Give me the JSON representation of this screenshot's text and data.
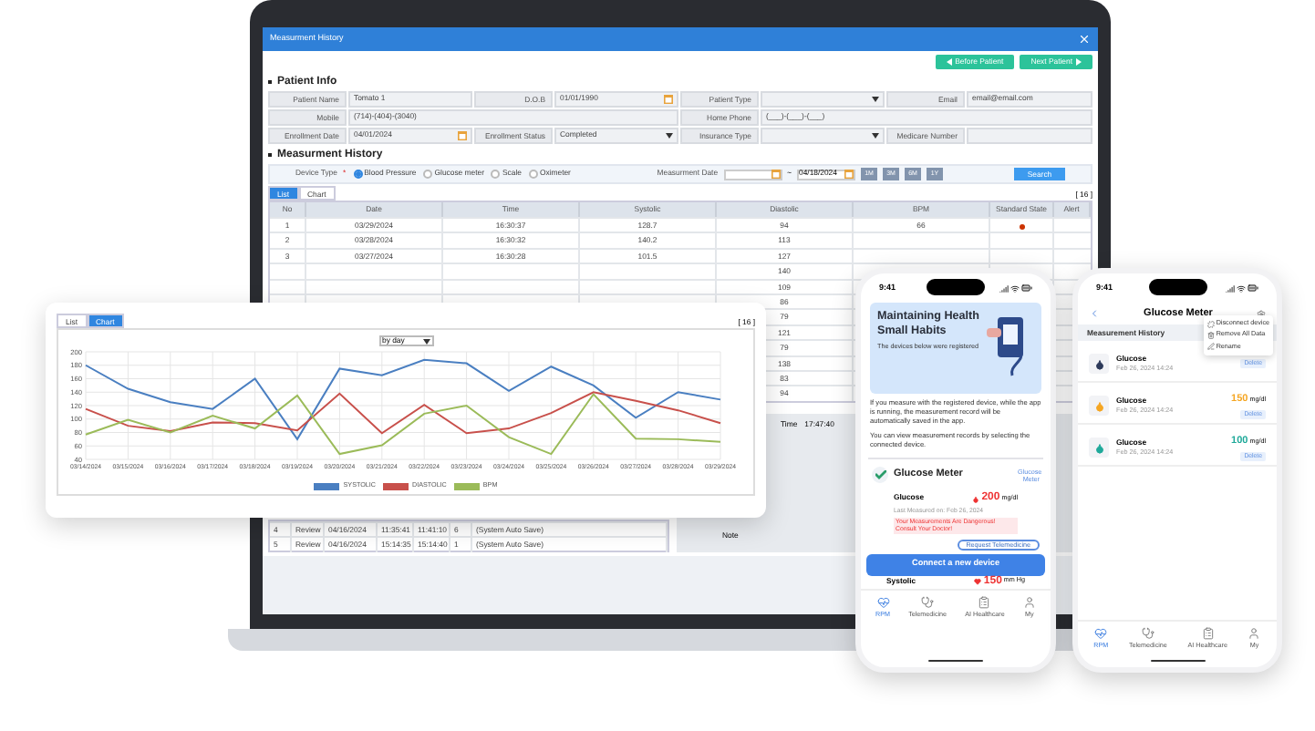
{
  "laptop_window": {
    "title": "Measurment History",
    "nav_buttons": [
      {
        "label": "Before Patient",
        "kind": "prev"
      },
      {
        "label": "Next Patient",
        "kind": "next"
      }
    ],
    "patient_info": {
      "heading": "Patient Info",
      "fields": [
        {
          "label": "Patient Name",
          "value": "Tomato 1",
          "kind": "text"
        },
        {
          "label": "D.O.B",
          "value": "01/01/1990",
          "kind": "date"
        },
        {
          "label": "Patient Type",
          "kind": "select"
        },
        {
          "label": "Email",
          "value": "email@email.com",
          "kind": "text"
        },
        {
          "label": "Mobile",
          "value": "(714)-(404)-(3040)",
          "kind": "wide"
        },
        {
          "label": "Home Phone",
          "value": "(___)-(___)-(___)",
          "kind": "wide"
        },
        {
          "label": "Enrollment Date",
          "value": "04/01/2024",
          "kind": "date"
        },
        {
          "label": "Enrollment Status",
          "value": "Completed",
          "kind": "select"
        },
        {
          "label": "Insurance Type",
          "kind": "select"
        },
        {
          "label": "Medicare Number",
          "kind": "text"
        }
      ]
    },
    "history": {
      "heading": "Measurment History",
      "device_type_label": "Device Type",
      "required_mark": "*",
      "device_options": [
        {
          "label": "Blood Pressure",
          "selected": true
        },
        {
          "label": "Glucose meter",
          "selected": false
        },
        {
          "label": "Scale",
          "selected": false
        },
        {
          "label": "Oximeter",
          "selected": false
        }
      ],
      "date_label": "Measurment Date",
      "date_separator": "~",
      "date_to": "04/18/2024",
      "ranges": [
        "1M",
        "3M",
        "6M",
        "1Y"
      ],
      "search": "Search",
      "tabs": [
        {
          "label": "List",
          "selected": true
        },
        {
          "label": "Chart",
          "selected": false
        }
      ],
      "count": "[ 16 ]",
      "table": {
        "columns": [
          "No",
          "Date",
          "Time",
          "Systolic",
          "Diastolic",
          "BPM",
          "Standard State",
          "Alert"
        ],
        "rows": [
          {
            "no": "1",
            "date": "03/29/2024",
            "time": "16:30:37",
            "systolic": "128.7",
            "diastolic": "94",
            "bpm": "66",
            "color": "#cc3300"
          },
          {
            "no": "2",
            "date": "03/28/2024",
            "time": "16:30:32",
            "systolic": "140.2",
            "diastolic": "113"
          },
          {
            "no": "3",
            "date": "03/27/2024",
            "time": "16:30:28",
            "systolic": "101.5",
            "diastolic": "127"
          },
          {
            "diastolic": "140"
          },
          {
            "diastolic": "109"
          },
          {
            "diastolic": "86"
          },
          {
            "diastolic": "79"
          },
          {
            "diastolic": "121"
          },
          {
            "diastolic": "79"
          },
          {
            "diastolic": "138"
          },
          {
            "diastolic": "83"
          },
          {
            "diastolic": "94"
          }
        ]
      },
      "log": {
        "rows": [
          [
            "4",
            "Review",
            "04/16/2024",
            "11:35:41",
            "11:41:10",
            "6",
            "(System Auto Save)"
          ],
          [
            "5",
            "Review",
            "04/16/2024",
            "15:14:35",
            "15:14:40",
            "1",
            "(System Auto Save)"
          ]
        ],
        "time_label": "Time",
        "time_value": "17:47:40",
        "note": "Note"
      }
    }
  },
  "chart_card": {
    "tabs": [
      {
        "label": "List",
        "selected": false
      },
      {
        "label": "Chart",
        "selected": true
      }
    ],
    "count": "[ 16 ]",
    "period": "by day",
    "chart_data": {
      "type": "line",
      "grid": true,
      "legend": true,
      "x": [
        "03/14/2024",
        "03/15/2024",
        "03/16/2024",
        "03/17/2024",
        "03/18/2024",
        "03/19/2024",
        "03/20/2024",
        "03/21/2024",
        "03/22/2024",
        "03/23/2024",
        "03/24/2024",
        "03/25/2024",
        "03/26/2024",
        "03/27/2024",
        "03/28/2024",
        "03/29/2024"
      ],
      "ylim": [
        40,
        200
      ],
      "yticks": [
        40,
        60,
        80,
        100,
        120,
        140,
        160,
        180,
        200
      ],
      "series": [
        {
          "name": "SYSTOLIC",
          "color": "#4a7fc1",
          "values": [
            180,
            145,
            125,
            115,
            160,
            70,
            175,
            165,
            188,
            183,
            142,
            178,
            150,
            102,
            140,
            129
          ]
        },
        {
          "name": "DIASTOLIC",
          "color": "#c8504b",
          "values": [
            115,
            90,
            82,
            95,
            94,
            83,
            138,
            79,
            121,
            79,
            86,
            109,
            140,
            127,
            113,
            94
          ]
        },
        {
          "name": "BPM",
          "color": "#9bbb59",
          "values": [
            77,
            99,
            80,
            105,
            86,
            135,
            48,
            61,
            108,
            120,
            73,
            48,
            137,
            71,
            70,
            66
          ]
        }
      ]
    }
  },
  "phone_home": {
    "time": "9:41",
    "banner": {
      "title": "Maintaining Health Small Habits",
      "subtitle": "The devices below were registered"
    },
    "paragraphs": [
      "If you measure with the registered device, while the app is running, the measurement record will be automatically saved in the app.",
      "You can view measurement records by selecting the connected device."
    ],
    "device_card": {
      "name": "Glucose Meter",
      "link": "Glucose Meter",
      "reading_label": "Glucose",
      "value": "200",
      "unit": "mg/dl",
      "last_measured": "Last Measured on: Feb 26, 2024",
      "warning": "Your Measurements Are Dangerous! Consult Your Doctor!",
      "action": "Request Telemedicine"
    },
    "connect_button": "Connect a new device",
    "second_reading": {
      "label": "Systolic",
      "value": "150",
      "unit": "mm Hg"
    },
    "nav": [
      {
        "label": "RPM",
        "kind": "rpm",
        "selected": true
      },
      {
        "label": "Telemedicine",
        "kind": "tele",
        "selected": false
      },
      {
        "label": "AI Healthcare",
        "kind": "ai",
        "selected": false
      },
      {
        "label": "My",
        "kind": "my",
        "selected": false
      }
    ]
  },
  "phone_device": {
    "time": "9:41",
    "title": "Glucose Meter",
    "section": "Measurement History",
    "menu": [
      {
        "label": "Disconnect device",
        "kind": "disconnect"
      },
      {
        "label": "Remove All Data",
        "kind": "remove"
      },
      {
        "label": "Rename",
        "kind": "rename"
      }
    ],
    "items": [
      {
        "name": "Glucose",
        "time": "Feb 26, 2024 14:24",
        "color": "#2d3a5a",
        "action": "Delete"
      },
      {
        "name": "Glucose",
        "time": "Feb 26, 2024 14:24",
        "value": "150",
        "unit": "mg/dl",
        "color": "#f5a623",
        "action": "Delete"
      },
      {
        "name": "Glucose",
        "time": "Feb 26, 2024 14:24",
        "value": "100",
        "unit": "mg/dl",
        "color": "#1fa99a",
        "action": "Delete"
      }
    ],
    "nav": [
      {
        "label": "RPM",
        "kind": "rpm",
        "selected": true
      },
      {
        "label": "Telemedicine",
        "kind": "tele",
        "selected": false
      },
      {
        "label": "AI Healthcare",
        "kind": "ai",
        "selected": false
      },
      {
        "label": "My",
        "kind": "my",
        "selected": false
      }
    ]
  }
}
